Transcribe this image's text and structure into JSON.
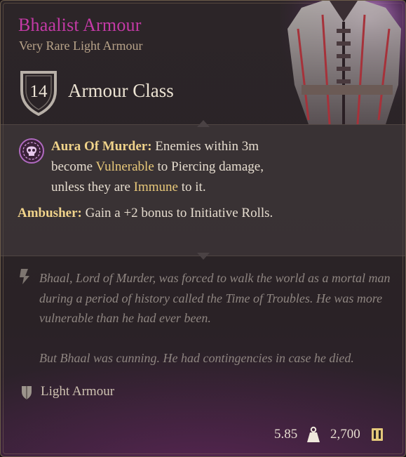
{
  "item": {
    "name": "Bhaalist Armour",
    "rarity_type": "Very Rare Light Armour",
    "armour_class_value": "14",
    "armour_class_label": "Armour Class"
  },
  "effects": [
    {
      "icon": "skull-aura-icon",
      "title": "Aura Of Murder:",
      "text_1": " Enemies within 3m become ",
      "keyword_1": "Vulnerable",
      "text_2": " to Piercing damage, unless they are ",
      "keyword_2": "Immune",
      "text_3": " to it."
    },
    {
      "title": "Ambusher:",
      "text": " Gain a +2 bonus to Initiative Rolls."
    }
  ],
  "lore": {
    "paragraph_1": "Bhaal, Lord of Murder, was forced to walk the world as a mortal man during a period of history called the Time of Troubles. He was more vulnerable than he had ever been.",
    "paragraph_2": "But Bhaal was cunning. He had contingencies in case he died."
  },
  "armour_type": {
    "icon": "light-armour-icon",
    "label": "Light Armour"
  },
  "footer": {
    "weight": "5.85",
    "weight_icon": "weight-icon",
    "price": "2,700",
    "price_icon": "gold-coin-icon"
  },
  "colors": {
    "name": "#c43aa6",
    "keyword": "#f0d38a",
    "highlight": "#e9c97a",
    "lore": "#8e8580"
  }
}
